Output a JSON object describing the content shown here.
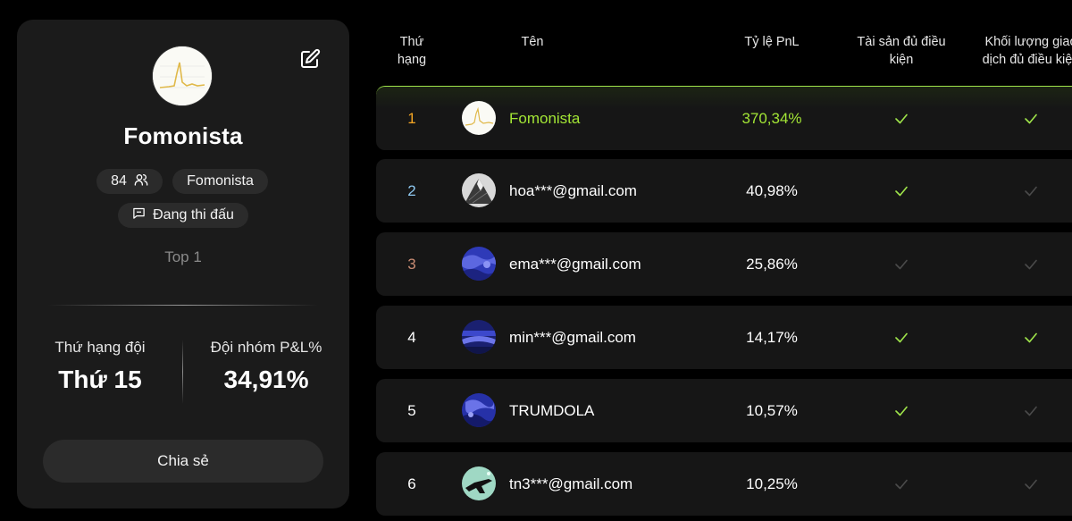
{
  "colors": {
    "accent": "#a3e635",
    "check_on": "#9ee34a",
    "check_off": "#4a4a4a",
    "gold": "#f5a623",
    "silver": "#8ec8f0",
    "bronze": "#c98c74"
  },
  "team": {
    "name": "Fomonista",
    "members": "84",
    "tag": "Fomonista",
    "status": "Đang thi đấu",
    "top": "Top 1",
    "rank_label": "Thứ hạng đội",
    "rank_value": "Thứ 15",
    "pnl_label": "Đội nhóm P&L%",
    "pnl_value": "34,91%",
    "share_label": "Chia sẻ"
  },
  "table": {
    "headers": {
      "rank_l1": "Thứ",
      "rank_l2": "hạng",
      "name": "Tên",
      "pnl": "Tỷ lệ PnL",
      "assets_l1": "Tài sản đủ điều",
      "assets_l2": "kiện",
      "volume_l1": "Khối lượng giao",
      "volume_l2": "dịch đủ điều kiện"
    },
    "rows": [
      {
        "rank": "1",
        "name": "Fomonista",
        "pnl": "370,34%",
        "assets_ok": true,
        "volume_ok": true
      },
      {
        "rank": "2",
        "name": "hoa***@gmail.com",
        "pnl": "40,98%",
        "assets_ok": true,
        "volume_ok": false
      },
      {
        "rank": "3",
        "name": "ema***@gmail.com",
        "pnl": "25,86%",
        "assets_ok": false,
        "volume_ok": false
      },
      {
        "rank": "4",
        "name": "min***@gmail.com",
        "pnl": "14,17%",
        "assets_ok": true,
        "volume_ok": true
      },
      {
        "rank": "5",
        "name": "TRUMDOLA",
        "pnl": "10,57%",
        "assets_ok": true,
        "volume_ok": false
      },
      {
        "rank": "6",
        "name": "tn3***@gmail.com",
        "pnl": "10,25%",
        "assets_ok": false,
        "volume_ok": false
      }
    ]
  }
}
